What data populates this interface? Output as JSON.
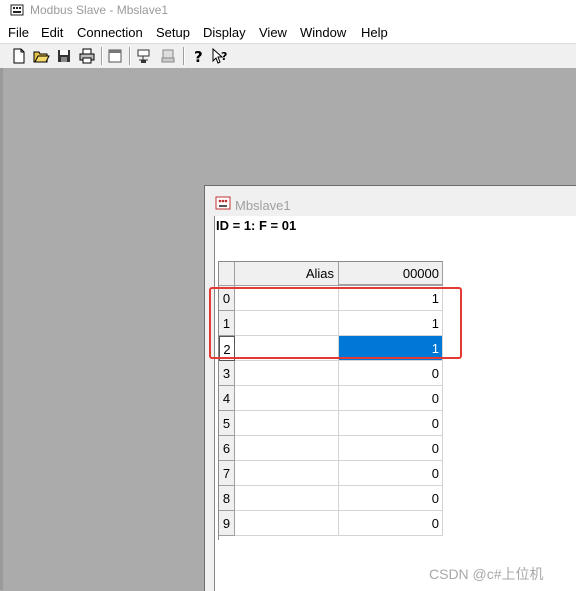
{
  "window": {
    "title": "Modbus Slave - Mbslave1",
    "icon": "modbus-app-icon"
  },
  "menu": [
    "File",
    "Edit",
    "Connection",
    "Setup",
    "Display",
    "View",
    "Window",
    "Help"
  ],
  "toolbar": [
    {
      "icon": "new-document-icon"
    },
    {
      "icon": "open-folder-icon"
    },
    {
      "icon": "save-disk-icon"
    },
    {
      "icon": "print-icon"
    },
    {
      "icon": "window-icon"
    },
    {
      "icon": "connect-icon"
    },
    {
      "icon": "disconnect-icon"
    },
    {
      "icon": "help-question-icon"
    },
    {
      "icon": "context-help-icon"
    }
  ],
  "child": {
    "title": "Mbslave1",
    "header": "ID = 1: F = 01",
    "grid": {
      "columns": [
        "Alias",
        "00000"
      ],
      "rows": [
        {
          "index": "0",
          "alias": "",
          "value": "1"
        },
        {
          "index": "1",
          "alias": "",
          "value": "1"
        },
        {
          "index": "2",
          "alias": "",
          "value": "1"
        },
        {
          "index": "3",
          "alias": "",
          "value": "0"
        },
        {
          "index": "4",
          "alias": "",
          "value": "0"
        },
        {
          "index": "5",
          "alias": "",
          "value": "0"
        },
        {
          "index": "6",
          "alias": "",
          "value": "0"
        },
        {
          "index": "7",
          "alias": "",
          "value": "0"
        },
        {
          "index": "8",
          "alias": "",
          "value": "0"
        },
        {
          "index": "9",
          "alias": "",
          "value": "0"
        }
      ],
      "selected_row": 2
    }
  },
  "watermark": "CSDN @c#上位机",
  "colors": {
    "selection": "#0078d7",
    "annotation": "#e53935",
    "mdi_background": "#ababab"
  }
}
